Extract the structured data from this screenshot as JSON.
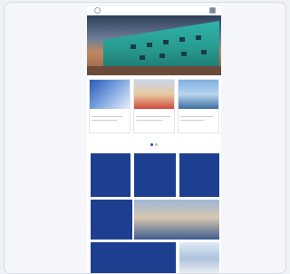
{
  "icons": {
    "menu": "circle-menu-icon",
    "account": "account-icon"
  },
  "colors": {
    "brand_blue": "#1d3f8f",
    "teal_building": "#2fb3a7"
  },
  "cards": [
    {
      "tag": "",
      "title": "",
      "image": "graduates-poster"
    },
    {
      "tag": "",
      "title": "",
      "image": "people-event"
    },
    {
      "tag": "",
      "title": "",
      "image": "harbour-photo"
    }
  ],
  "carousel": {
    "pages": 2,
    "active": 1
  },
  "tiles": [
    {
      "label": ""
    },
    {
      "label": ""
    },
    {
      "label": ""
    },
    {
      "label": ""
    },
    {
      "label": ""
    },
    {
      "label": ""
    },
    {
      "label": ""
    }
  ]
}
